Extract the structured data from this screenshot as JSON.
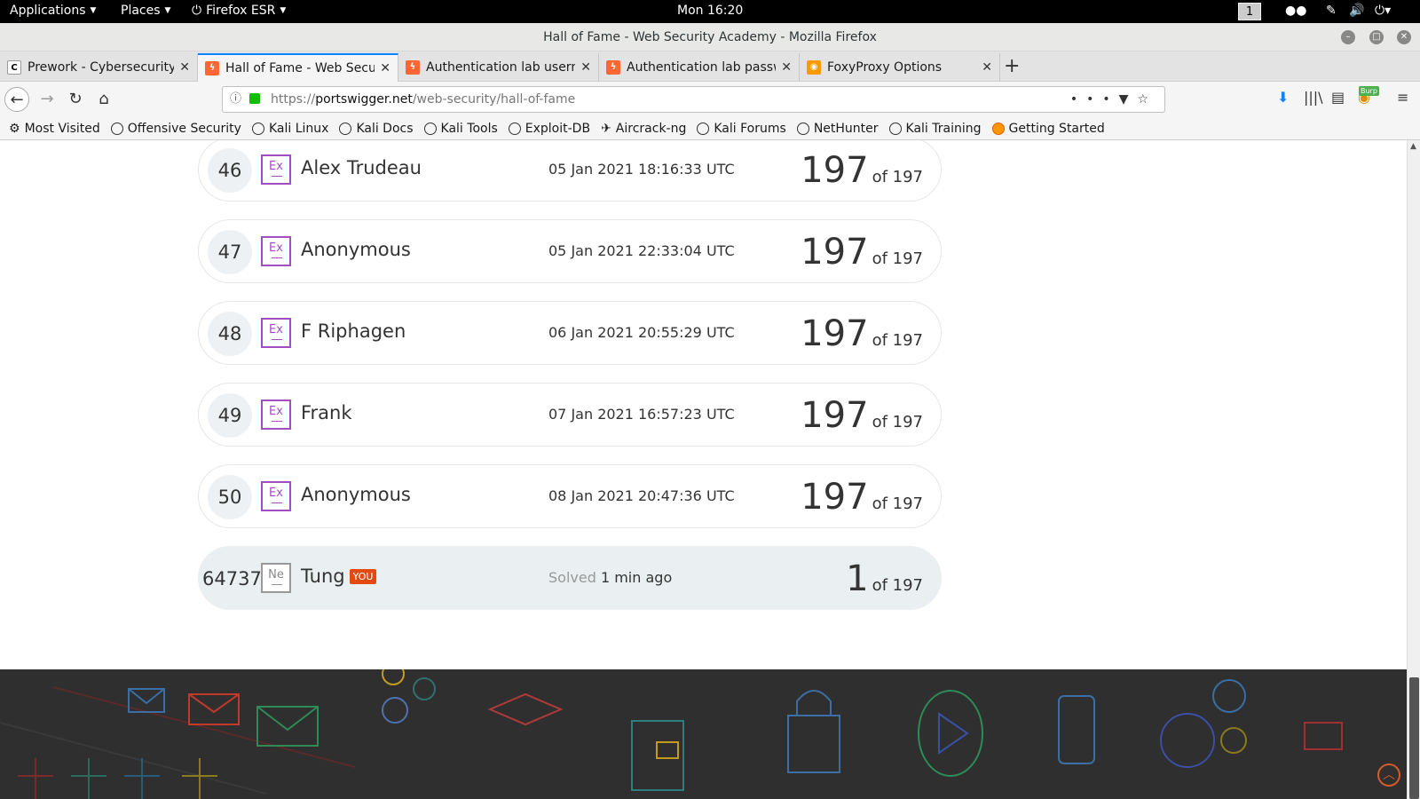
{
  "topbar": {
    "applications": "Applications",
    "places": "Places",
    "browser": "Firefox ESR",
    "clock": "Mon 16:20",
    "workspace": "1"
  },
  "window": {
    "title": "Hall of Fame - Web Security Academy - Mozilla Firefox"
  },
  "tabs": [
    {
      "title": "Prework - Cybersecurity",
      "favicon_color": "#ffffff"
    },
    {
      "title": "Hall of Fame - Web Secu",
      "favicon_color": "#ff6633"
    },
    {
      "title": "Authentication lab userna",
      "favicon_color": "#ff6633"
    },
    {
      "title": "Authentication lab passw",
      "favicon_color": "#ff6633"
    },
    {
      "title": "FoxyProxy Options",
      "favicon_color": "#ff9900"
    }
  ],
  "navbar": {
    "url_prefix": "https://",
    "url_domain": "portswigger.net",
    "url_path": "/web-security/hall-of-fame",
    "burp_label": "Burp"
  },
  "bookmarks": [
    "Most Visited",
    "Offensive Security",
    "Kali Linux",
    "Kali Docs",
    "Kali Tools",
    "Exploit-DB",
    "Aircrack-ng",
    "Kali Forums",
    "NetHunter",
    "Kali Training",
    "Getting Started"
  ],
  "leaderboard": {
    "rows": [
      {
        "rank": "46",
        "badge": "Ex",
        "name": "Alex Trudeau",
        "date": "05 Jan 2021 18:16:33 UTC",
        "score": "197",
        "of": "of 197"
      },
      {
        "rank": "47",
        "badge": "Ex",
        "name": "Anonymous",
        "date": "05 Jan 2021 22:33:04 UTC",
        "score": "197",
        "of": "of 197"
      },
      {
        "rank": "48",
        "badge": "Ex",
        "name": "F Riphagen",
        "date": "06 Jan 2021 20:55:29 UTC",
        "score": "197",
        "of": "of 197"
      },
      {
        "rank": "49",
        "badge": "Ex",
        "name": "Frank",
        "date": "07 Jan 2021 16:57:23 UTC",
        "score": "197",
        "of": "of 197"
      },
      {
        "rank": "50",
        "badge": "Ex",
        "name": "Anonymous",
        "date": "08 Jan 2021 20:47:36 UTC",
        "score": "197",
        "of": "of 197"
      }
    ],
    "you": {
      "rank": "64737",
      "badge": "Ne",
      "name": "Tung",
      "tag": "YOU",
      "solved_label": "Solved",
      "solved_time": "1 min ago",
      "score": "1",
      "of": "of 197"
    }
  },
  "colors": {
    "expert_badge": "#a24ec2",
    "you_tag": "#e24a12",
    "accent_tab": "#0a84ff",
    "footer_bg": "#2f2f2f"
  }
}
